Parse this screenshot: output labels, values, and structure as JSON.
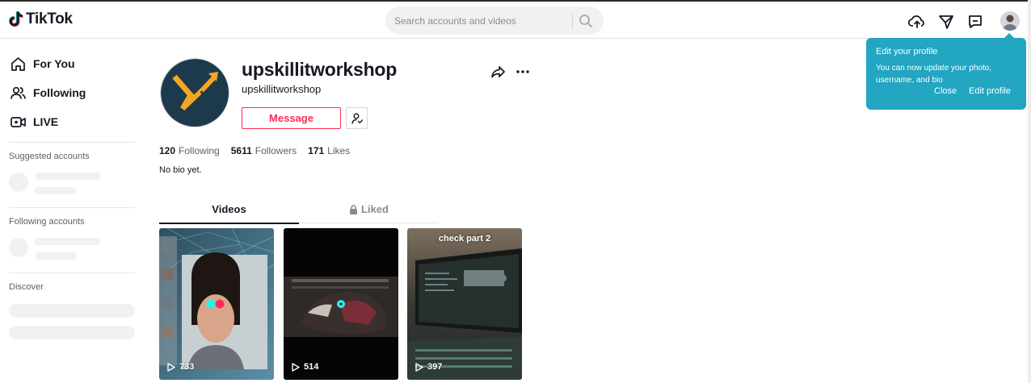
{
  "header": {
    "logo_text": "TikTok",
    "search_placeholder": "Search accounts and videos",
    "icons": [
      "upload-icon",
      "send-icon",
      "inbox-icon"
    ]
  },
  "sidebar": {
    "nav": [
      {
        "label": "For You",
        "icon": "home-icon"
      },
      {
        "label": "Following",
        "icon": "users-icon"
      },
      {
        "label": "LIVE",
        "icon": "live-icon"
      }
    ],
    "suggested_title": "Suggested accounts",
    "following_title": "Following accounts",
    "discover_title": "Discover"
  },
  "profile": {
    "username": "upskillitworkshop",
    "handle": "upskillitworkshop",
    "message_label": "Message",
    "stats": [
      {
        "value": "120",
        "label": "Following"
      },
      {
        "value": "5611",
        "label": "Followers"
      },
      {
        "value": "171",
        "label": "Likes"
      }
    ],
    "bio": "No bio yet."
  },
  "tabs": {
    "videos": "Videos",
    "liked": "Liked"
  },
  "videos": [
    {
      "views": "733",
      "caption": ""
    },
    {
      "views": "514",
      "caption": ""
    },
    {
      "views": "397",
      "caption": "check part 2"
    }
  ],
  "tooltip": {
    "title": "Edit your profile",
    "body": "You can now update your photo, username, and bio",
    "close": "Close",
    "edit": "Edit profile"
  },
  "colors": {
    "accent": "#fe2c55",
    "tooltip_bg": "#22a6c2",
    "avatar_bg": "#1d3a4d",
    "avatar_mark": "#f5a623"
  }
}
